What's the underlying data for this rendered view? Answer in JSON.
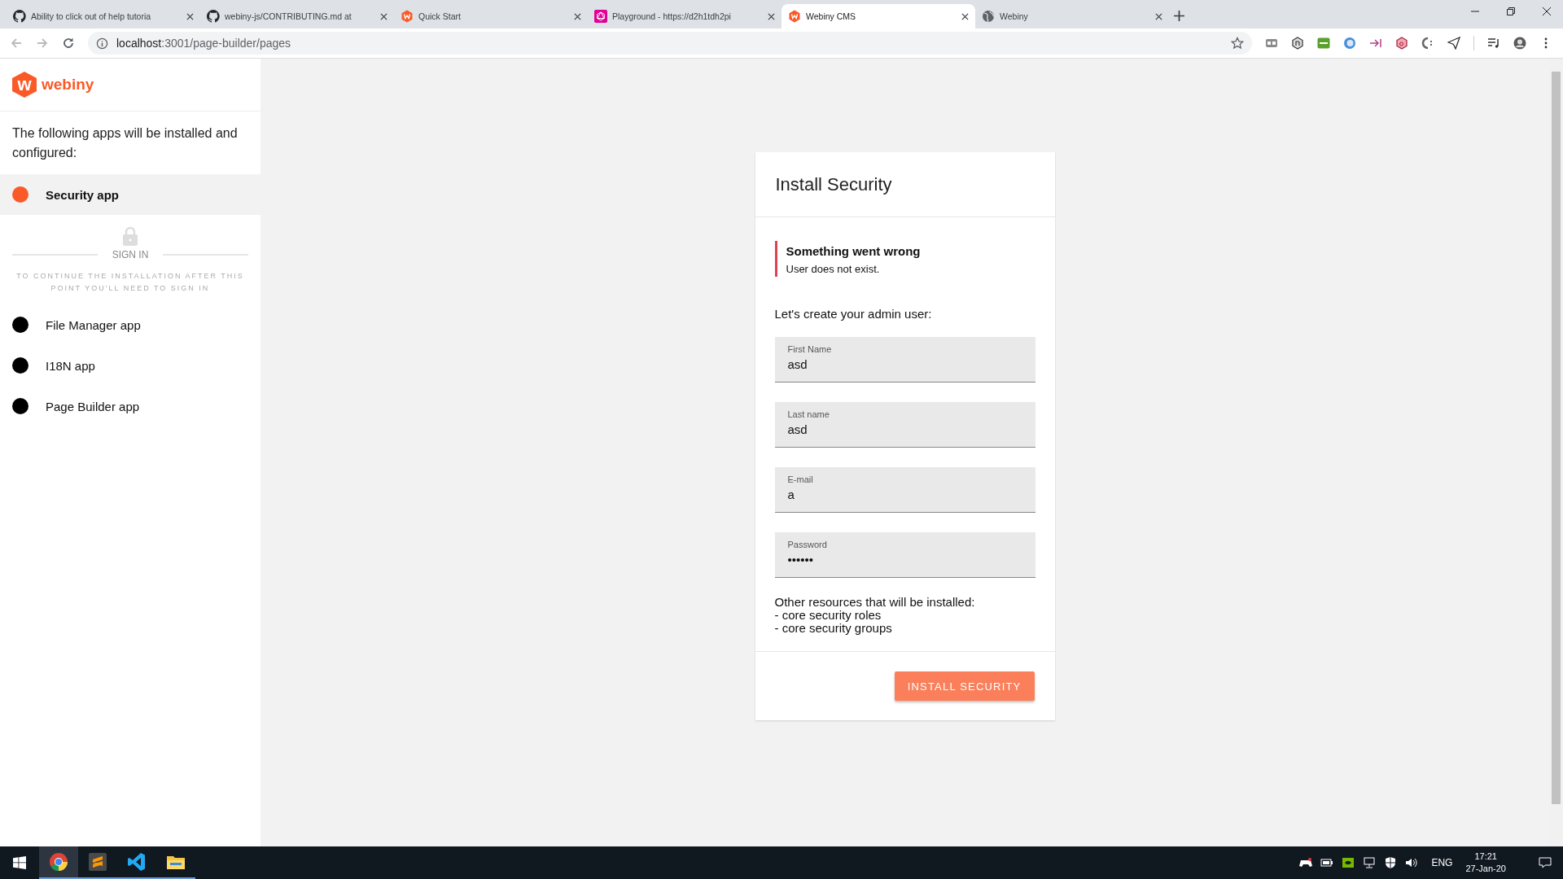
{
  "browser": {
    "tabs": [
      {
        "title": "Ability to click out of help tutoria",
        "kind": "github",
        "selected": false
      },
      {
        "title": "webiny-js/CONTRIBUTING.md at",
        "kind": "github",
        "selected": false
      },
      {
        "title": "Quick Start",
        "kind": "webiny",
        "selected": false
      },
      {
        "title": "Playground - https://d2h1tdh2pi",
        "kind": "graphql",
        "selected": false
      },
      {
        "title": "Webiny CMS",
        "kind": "webiny",
        "selected": true
      },
      {
        "title": "Webiny",
        "kind": "globe",
        "selected": false
      }
    ],
    "address": {
      "host": "localhost",
      "rest": ":3001/page-builder/pages"
    }
  },
  "sidebar": {
    "logo": {
      "mark": "w",
      "wordmark": "webiny"
    },
    "intro": "The following apps will be installed and configured:",
    "steps": [
      {
        "kind": "app",
        "name": "Security app",
        "active": true
      },
      {
        "kind": "divider",
        "label": "SIGN IN",
        "note": "TO CONTINUE THE INSTALLATION AFTER THIS POINT YOU'LL NEED TO SIGN IN"
      },
      {
        "kind": "app",
        "name": "File Manager app",
        "active": false
      },
      {
        "kind": "app",
        "name": "I18N app",
        "active": false
      },
      {
        "kind": "app",
        "name": "Page Builder app",
        "active": false
      }
    ]
  },
  "card": {
    "title": "Install Security",
    "alert": {
      "title": "Something went wrong",
      "message": "User does not exist."
    },
    "intro": "Let's create your admin user:",
    "fields": [
      {
        "label": "First Name",
        "value": "asd"
      },
      {
        "label": "Last name",
        "value": "asd"
      },
      {
        "label": "E-mail",
        "value": "a"
      },
      {
        "label": "Password",
        "value": "••••••"
      }
    ],
    "note": [
      "Other resources that will be installed:",
      "- core security roles",
      "- core security groups"
    ],
    "button": "INSTALL SECURITY"
  },
  "taskbar": {
    "apps": [
      {
        "kind": "chrome",
        "selected": true
      },
      {
        "kind": "sublime",
        "selected": false
      },
      {
        "kind": "vscode",
        "selected": false
      },
      {
        "kind": "explorer",
        "selected": false
      }
    ],
    "language": "ENG",
    "time": "17:21",
    "date": "27-Jan-20"
  }
}
